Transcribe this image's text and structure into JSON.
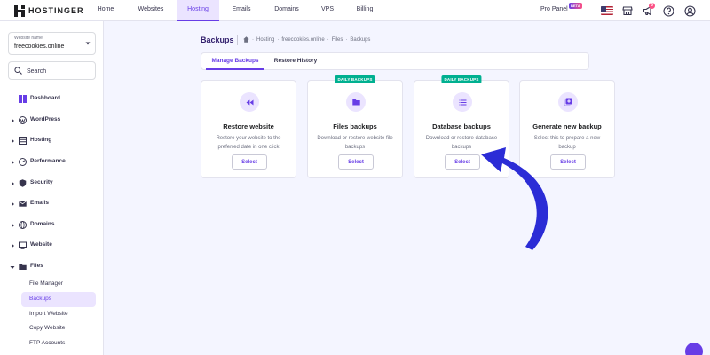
{
  "brand": {
    "name": "HOSTINGER",
    "accent": "#673de6",
    "badge_color": "#00b090",
    "arrow_color": "#2b2cd6"
  },
  "topnav": {
    "items": [
      {
        "label": "Home"
      },
      {
        "label": "Websites"
      },
      {
        "label": "Hosting",
        "active": true
      },
      {
        "label": "Emails"
      },
      {
        "label": "Domains"
      },
      {
        "label": "VPS"
      },
      {
        "label": "Billing"
      }
    ],
    "pro_panel": "Pro Panel",
    "beta": "BETA",
    "icons": [
      "us-flag-icon",
      "store-icon",
      "megaphone-icon",
      "help-icon",
      "account-icon"
    ],
    "notification_count": "6"
  },
  "sidebar": {
    "website_label": "Website name",
    "website_value": "freecookies.online",
    "search_placeholder": "Search",
    "items": [
      {
        "label": "Dashboard",
        "icon": "dashboard-icon"
      },
      {
        "label": "WordPress",
        "icon": "wordpress-icon"
      },
      {
        "label": "Hosting",
        "icon": "hosting-icon"
      },
      {
        "label": "Performance",
        "icon": "performance-icon"
      },
      {
        "label": "Security",
        "icon": "shield-icon"
      },
      {
        "label": "Emails",
        "icon": "mail-icon"
      },
      {
        "label": "Domains",
        "icon": "globe-icon"
      },
      {
        "label": "Website",
        "icon": "monitor-icon"
      },
      {
        "label": "Files",
        "icon": "folder-icon",
        "expanded": true
      }
    ],
    "files_sub": [
      {
        "label": "File Manager"
      },
      {
        "label": "Backups",
        "active": true
      },
      {
        "label": "Import Website"
      },
      {
        "label": "Copy Website"
      },
      {
        "label": "FTP Accounts"
      }
    ]
  },
  "main": {
    "title": "Backups",
    "breadcrumb": [
      "Hosting",
      "freecookies.online",
      "Files",
      "Backups"
    ],
    "tabs": [
      {
        "label": "Manage Backups",
        "active": true
      },
      {
        "label": "Restore History"
      }
    ],
    "cards": [
      {
        "title": "Restore website",
        "desc": "Restore your website to the preferred date in one click",
        "button": "Select",
        "badge": "",
        "icon": "rewind-icon"
      },
      {
        "title": "Files backups",
        "desc": "Download or restore website file backups",
        "button": "Select",
        "badge": "DAILY BACKUPS",
        "icon": "folder-icon"
      },
      {
        "title": "Database backups",
        "desc": "Download or restore database backups",
        "button": "Select",
        "badge": "DAILY BACKUPS",
        "icon": "database-list-icon"
      },
      {
        "title": "Generate new backup",
        "desc": "Select this to prepare a new backup",
        "button": "Select",
        "badge": "",
        "icon": "add-backup-icon"
      }
    ]
  }
}
